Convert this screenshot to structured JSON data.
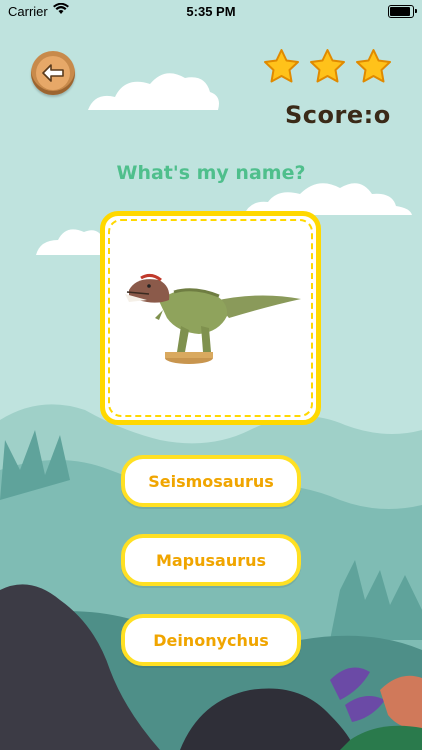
{
  "status_bar": {
    "carrier": "Carrier",
    "time": "5:35 PM"
  },
  "back_button": {
    "icon": "back-arrow-icon"
  },
  "stars": {
    "count": 3,
    "filled": 3,
    "color": "#ffc21a"
  },
  "score": {
    "label": "Score:o"
  },
  "question": {
    "text": "What's my name?"
  },
  "picture": {
    "subject": "dinosaur-toy-image"
  },
  "answers": [
    {
      "label": "Seismosaurus"
    },
    {
      "label": "Mapusaurus"
    },
    {
      "label": "Deinonychus"
    }
  ],
  "colors": {
    "accent_yellow": "#ffe023",
    "answer_text": "#f0a500",
    "question_text": "#4fbf8c"
  }
}
